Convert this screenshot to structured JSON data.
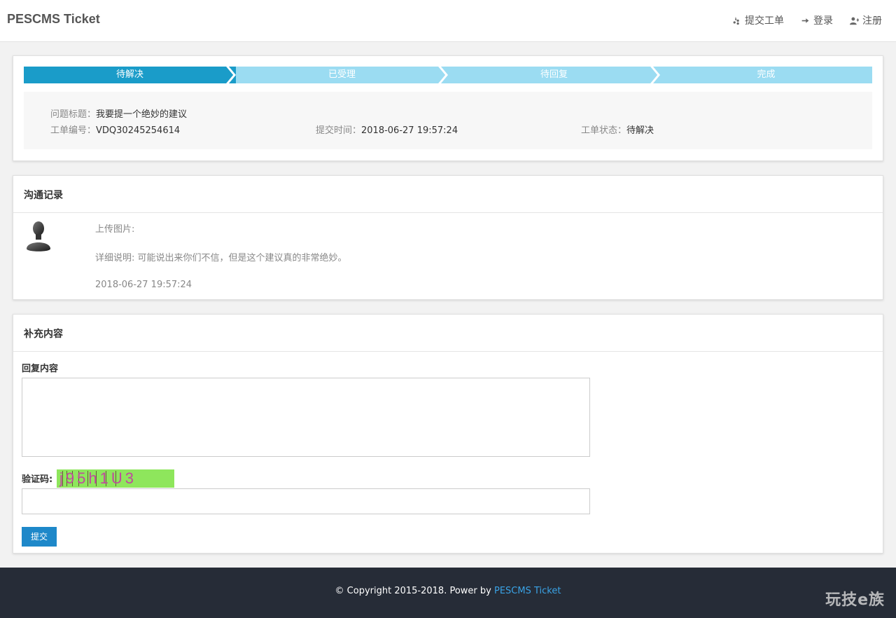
{
  "header": {
    "brand": "PESCMS Ticket",
    "nav": [
      {
        "label": "提交工单",
        "icon": "yelp-icon"
      },
      {
        "label": "登录",
        "icon": "sign-in-icon"
      },
      {
        "label": "注册",
        "icon": "user-plus-icon"
      }
    ]
  },
  "progress": {
    "steps": [
      "待解决",
      "已受理",
      "待回复",
      "完成"
    ],
    "active_index": 0,
    "colors": {
      "active": "#1a9cc9",
      "inactive": "#9bdcf2"
    }
  },
  "ticket": {
    "title_label": "问题标题：",
    "title_value": "我要提一个绝妙的建议",
    "number_label": "工单编号：",
    "number_value": "VDQ30245254614",
    "time_label": "提交时间：",
    "time_value": "2018-06-27 19:57:24",
    "status_label": "工单状态：",
    "status_value": "待解决"
  },
  "records": {
    "title": "沟通记录",
    "items": [
      {
        "upload_label": "上传图片:",
        "detail": "详细说明: 可能说出来你们不信，但是这个建议真的非常绝妙。",
        "time": "2018-06-27 19:57:24"
      }
    ]
  },
  "supplement": {
    "title": "补充内容",
    "reply_label": "回复内容",
    "reply_value": "",
    "captcha_label": "验证码:",
    "captcha_text": "j95h1U3",
    "captcha_value": "",
    "submit_label": "提交"
  },
  "footer": {
    "copyright": "© Copyright 2015-2018. Power by ",
    "link_text": "PESCMS Ticket",
    "watermark": "玩技e族"
  }
}
